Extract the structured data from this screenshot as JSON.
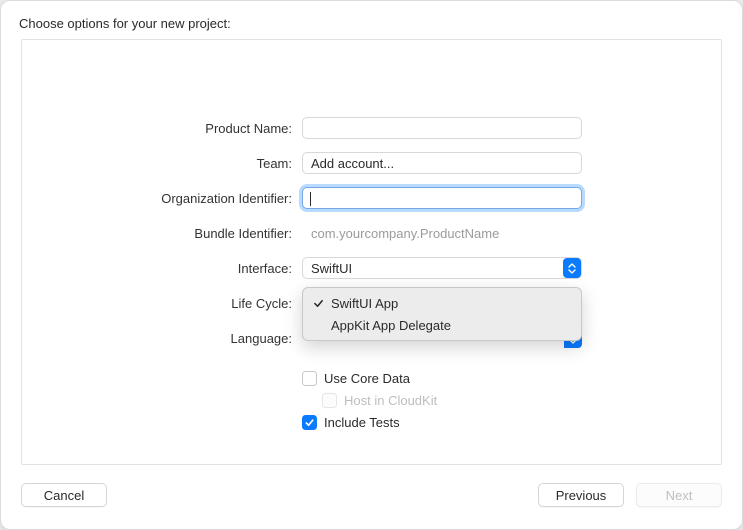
{
  "header": {
    "title": "Choose options for your new project:"
  },
  "form": {
    "product_name": {
      "label": "Product Name:",
      "value": ""
    },
    "team": {
      "label": "Team:",
      "button": "Add account..."
    },
    "org_id": {
      "label": "Organization Identifier:",
      "value": ""
    },
    "bundle_id": {
      "label": "Bundle Identifier:",
      "value": "com.yourcompany.ProductName"
    },
    "interface": {
      "label": "Interface:",
      "value": "SwiftUI"
    },
    "life_cycle": {
      "label": "Life Cycle:",
      "options": [
        "SwiftUI App",
        "AppKit App Delegate"
      ],
      "selected_index": 0
    },
    "language": {
      "label": "Language:"
    },
    "core_data": {
      "label": "Use Core Data",
      "checked": false
    },
    "cloudkit": {
      "label": "Host in CloudKit",
      "checked": false,
      "disabled": true
    },
    "tests": {
      "label": "Include Tests",
      "checked": true
    }
  },
  "footer": {
    "cancel": "Cancel",
    "previous": "Previous",
    "next": "Next"
  }
}
